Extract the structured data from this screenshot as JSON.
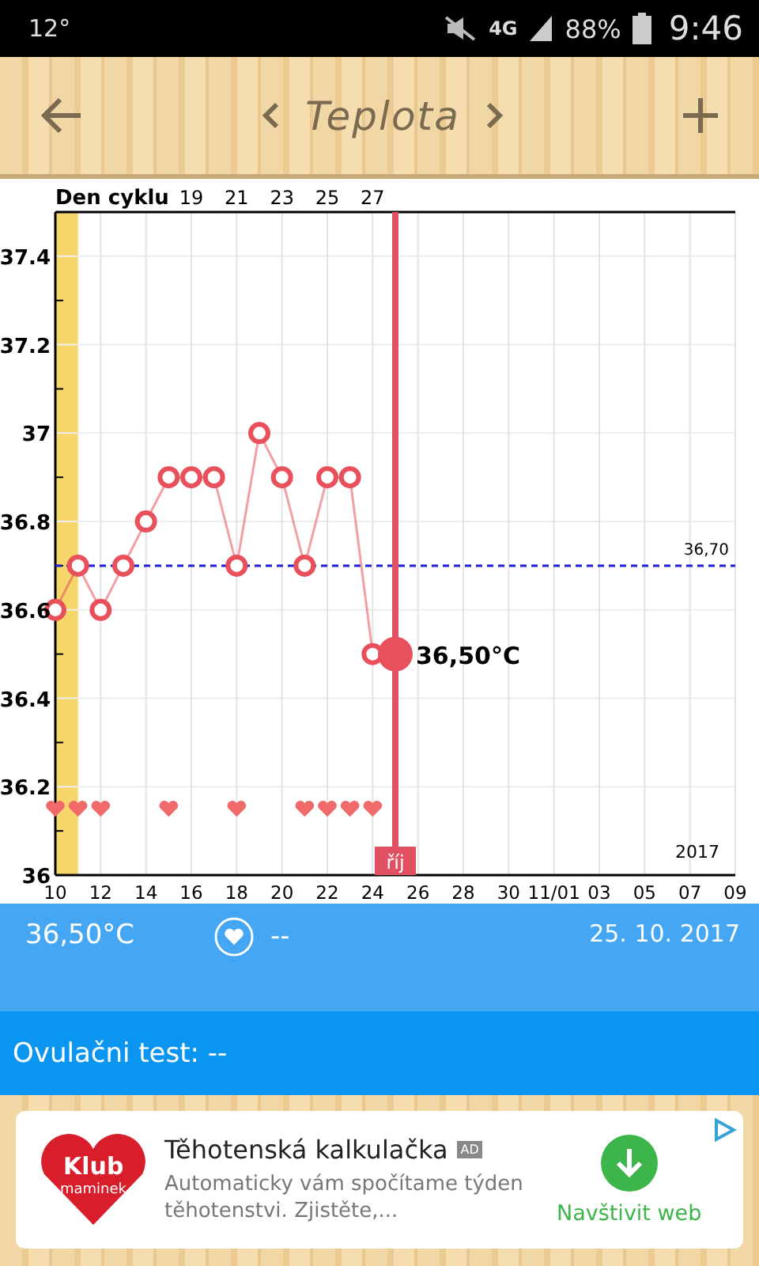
{
  "status_bar": {
    "temperature": "12°",
    "network": "4G",
    "battery": "88%",
    "time": "9:46"
  },
  "header": {
    "title": "Teplota"
  },
  "chart": {
    "chart_data": {
      "type": "line",
      "xlim": [
        "2017-10-10",
        "2017-11-09"
      ],
      "ylim": [
        36,
        37.5
      ],
      "x": [
        "2017-10-10",
        "2017-10-11",
        "2017-10-12",
        "2017-10-13",
        "2017-10-14",
        "2017-10-15",
        "2017-10-16",
        "2017-10-17",
        "2017-10-18",
        "2017-10-19",
        "2017-10-20",
        "2017-10-21",
        "2017-10-22",
        "2017-10-23",
        "2017-10-24",
        "2017-10-25"
      ],
      "series": [
        {
          "color": "#e8505b",
          "marker": "circle",
          "values": [
            36.6,
            36.7,
            36.6,
            36.7,
            36.8,
            36.9,
            36.9,
            36.9,
            36.7,
            37.0,
            36.9,
            36.7,
            36.9,
            36.9,
            36.5,
            36.5
          ]
        },
        {
          "color": "#f06a6a",
          "type": "scatter",
          "values": [
            36.15,
            36.15,
            36.15,
            null,
            null,
            36.15,
            null,
            null,
            36.15,
            null,
            null,
            36.15,
            36.15,
            36.15,
            36.15,
            null
          ]
        }
      ],
      "grid": true,
      "yticks": [
        36,
        36.2,
        36.4,
        36.6,
        36.8,
        37,
        37.2,
        37.4
      ],
      "xticks": [
        {
          "value": "2017-10-10",
          "label": "10"
        },
        {
          "value": "2017-10-12",
          "label": "12"
        },
        {
          "value": "2017-10-14",
          "label": "14"
        },
        {
          "value": "2017-10-16",
          "label": "16"
        },
        {
          "value": "2017-10-18",
          "label": "18"
        },
        {
          "value": "2017-10-20",
          "label": "20"
        },
        {
          "value": "2017-10-22",
          "label": "22"
        },
        {
          "value": "2017-10-24",
          "label": "24"
        },
        {
          "value": "2017-10-26",
          "label": "26"
        },
        {
          "value": "2017-10-28",
          "label": "28"
        },
        {
          "value": "2017-10-30",
          "label": "30"
        },
        {
          "value": "2017-11-01",
          "label": "11/01"
        },
        {
          "value": "2017-11-03",
          "label": "03"
        },
        {
          "value": "2017-11-05",
          "label": "05"
        },
        {
          "value": "2017-11-07",
          "label": "07"
        },
        {
          "value": "2017-11-09",
          "label": "09"
        }
      ],
      "bands": [
        {
          "axis": "x",
          "from": "2017-10-10",
          "to": "2017-10-11",
          "color": "#f6d66a"
        }
      ],
      "ref_lines": [
        {
          "axis": "y",
          "value": 36.7,
          "label": "36,70",
          "color": "#2020d0"
        },
        {
          "axis": "x",
          "value": "2017-10-25",
          "label": "říj",
          "color": "#e05060"
        }
      ],
      "annotations": [
        {
          "x": "2017-10-25",
          "y": 36.5,
          "text": "36,50°C"
        }
      ]
    },
    "cycle_day_title": "Den cyklu",
    "cycle_days": [
      "19",
      "21",
      "23",
      "25",
      "27"
    ],
    "year": "2017"
  },
  "summary": {
    "temperature": "36,50°C",
    "intercourse": "--",
    "date": "25. 10. 2017"
  },
  "ovulation_test": {
    "text": "Ovulačni test: --"
  },
  "ad": {
    "logo_text": [
      "Klub",
      "maminek"
    ],
    "title": "Těhotenská kalkulačka",
    "badge": "AD",
    "description": "Automaticky vám spočítame týden těhotenstvi. Zjistěte,...",
    "button": "Navštivit web"
  }
}
